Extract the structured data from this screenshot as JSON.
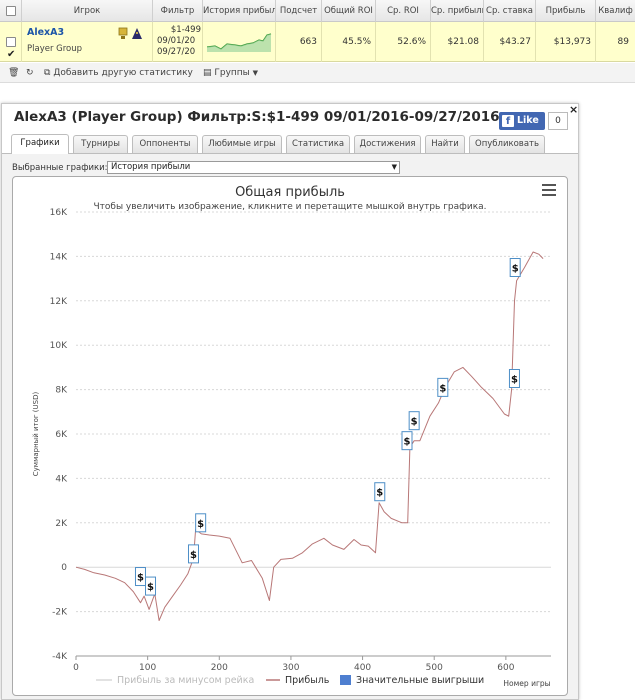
{
  "table": {
    "headers": [
      "Игрок",
      "Фильтр",
      "История прибыль",
      "Подсчет",
      "Общий ROI",
      "Ср. ROI",
      "Ср. прибыль",
      "Ср. ставка",
      "Прибыль",
      "Квалиф"
    ],
    "row": {
      "player": "AlexA3",
      "group": "Player Group",
      "filter": [
        "$1-499",
        "09/01/20",
        "09/27/20"
      ],
      "count": "663",
      "total_roi": "45.5%",
      "avg_roi": "52.6%",
      "avg_profit": "$21.08",
      "avg_stake": "$43.27",
      "profit": "$13,973",
      "qual": "89"
    }
  },
  "toolbar": {
    "add_stats": "Добавить другую статистику",
    "groups": "Группы"
  },
  "panel": {
    "title": "AlexA3 (Player Group) Фильтр:S:$1-499 09/01/2016-09/27/2016",
    "like": "Like",
    "like_count": "0",
    "close": "×",
    "tabs": [
      "Графики",
      "Турниры",
      "Оппоненты",
      "Любимые игры",
      "Статистика",
      "Достижения",
      "Найти",
      "Опубликовать"
    ],
    "selected_label": "Выбранные графики:",
    "selected_value": "История прибыли"
  },
  "chart_data": {
    "type": "line",
    "title": "Общая прибыль",
    "subtitle": "Чтобы увеличить изображение, кликните и перетащите мышкой внутрь графика.",
    "ylabel": "Суммарный итог (USD)",
    "xlabel": "Номер игры",
    "ylim": [
      -4000,
      16000
    ],
    "xlim": [
      0,
      663
    ],
    "y_ticks": [
      -4000,
      -2000,
      0,
      2000,
      4000,
      6000,
      8000,
      10000,
      12000,
      14000,
      16000
    ],
    "y_tick_labels": [
      "-4K",
      "-2K",
      "0",
      "2K",
      "4K",
      "6K",
      "8K",
      "10K",
      "12K",
      "14K",
      "16K"
    ],
    "x_ticks": [
      0,
      100,
      200,
      300,
      400,
      500,
      600
    ],
    "grid": true,
    "legend": "bottom",
    "series": [
      {
        "name": "Прибыль",
        "color": "#b87777",
        "points": [
          [
            0,
            0
          ],
          [
            12,
            -100
          ],
          [
            25,
            -250
          ],
          [
            40,
            -350
          ],
          [
            55,
            -500
          ],
          [
            68,
            -700
          ],
          [
            80,
            -1100
          ],
          [
            90,
            -1600
          ],
          [
            95,
            -1300
          ],
          [
            102,
            -1900
          ],
          [
            110,
            -1200
          ],
          [
            116,
            -2400
          ],
          [
            124,
            -1800
          ],
          [
            135,
            -1300
          ],
          [
            146,
            -800
          ],
          [
            156,
            -300
          ],
          [
            164,
            400
          ],
          [
            167,
            1700
          ],
          [
            175,
            1500
          ],
          [
            186,
            1450
          ],
          [
            200,
            1400
          ],
          [
            215,
            1300
          ],
          [
            232,
            200
          ],
          [
            245,
            300
          ],
          [
            260,
            -500
          ],
          [
            270,
            -1500
          ],
          [
            276,
            0
          ],
          [
            286,
            350
          ],
          [
            302,
            400
          ],
          [
            316,
            650
          ],
          [
            330,
            1050
          ],
          [
            346,
            1300
          ],
          [
            358,
            1000
          ],
          [
            374,
            800
          ],
          [
            388,
            1250
          ],
          [
            398,
            1000
          ],
          [
            408,
            950
          ],
          [
            418,
            650
          ],
          [
            423,
            2900
          ],
          [
            430,
            2500
          ],
          [
            440,
            2200
          ],
          [
            455,
            2000
          ],
          [
            463,
            2000
          ],
          [
            466,
            5400
          ],
          [
            472,
            5700
          ],
          [
            480,
            5700
          ],
          [
            494,
            6800
          ],
          [
            506,
            7400
          ],
          [
            515,
            8100
          ],
          [
            528,
            8800
          ],
          [
            540,
            9000
          ],
          [
            552,
            8600
          ],
          [
            566,
            8100
          ],
          [
            582,
            7600
          ],
          [
            598,
            6900
          ],
          [
            604,
            6800
          ],
          [
            608,
            8000
          ],
          [
            612,
            12000
          ],
          [
            615,
            12900
          ],
          [
            626,
            13500
          ],
          [
            638,
            14200
          ],
          [
            646,
            14100
          ],
          [
            652,
            13900
          ]
        ]
      },
      {
        "name": "Прибыль за минусом рейка",
        "color": "#d9d9d9",
        "points": []
      },
      {
        "name": "Значительные выигрыши",
        "color": "#4e7fd0",
        "points": [
          [
            90,
            -420
          ],
          [
            104,
            -850
          ],
          [
            164,
            600
          ],
          [
            174,
            2000
          ],
          [
            424,
            3400
          ],
          [
            462,
            5700
          ],
          [
            472,
            6600
          ],
          [
            512,
            8100
          ],
          [
            612,
            8500
          ],
          [
            613,
            13500
          ]
        ]
      }
    ],
    "marker_label": "$"
  }
}
